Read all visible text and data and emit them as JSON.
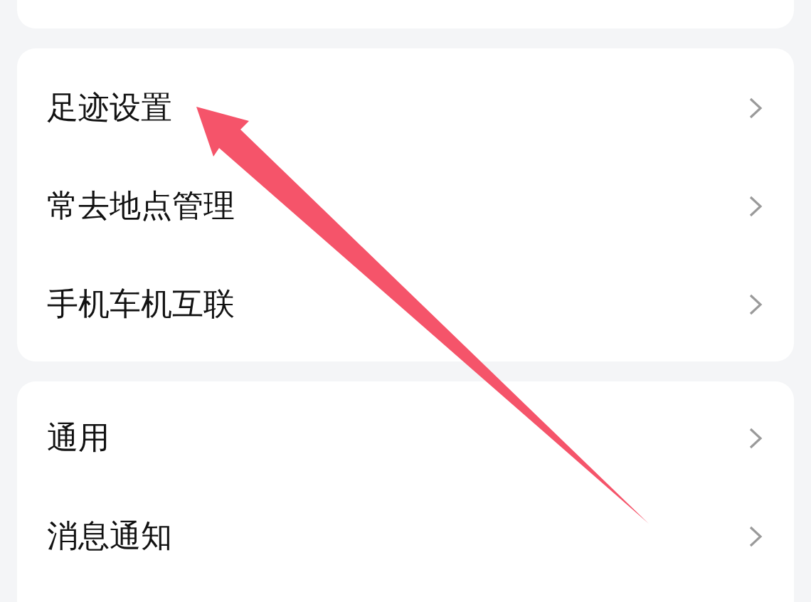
{
  "sections": [
    {
      "items": [
        {
          "label": "足迹设置"
        },
        {
          "label": "常去地点管理"
        },
        {
          "label": "手机车机互联"
        }
      ]
    },
    {
      "items": [
        {
          "label": "通用"
        },
        {
          "label": "消息通知"
        }
      ]
    }
  ]
}
